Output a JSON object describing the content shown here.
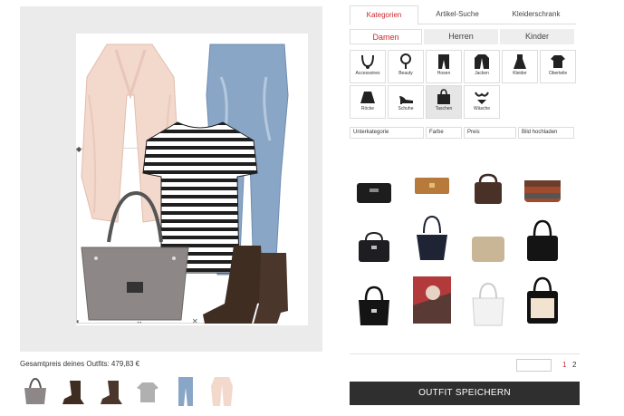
{
  "total_price_text": "Gesamtpreis deines Outfits: 479,83 €",
  "tabs": [
    {
      "label": "Kategorien"
    },
    {
      "label": "Artikel-Suche"
    },
    {
      "label": "Kleiderschrank"
    }
  ],
  "gender_tabs": [
    {
      "label": "Damen"
    },
    {
      "label": "Herren"
    },
    {
      "label": "Kinder"
    }
  ],
  "categories": [
    {
      "label": "Accessoires"
    },
    {
      "label": "Beauty"
    },
    {
      "label": "Hosen"
    },
    {
      "label": "Jacken"
    },
    {
      "label": "Kleider"
    },
    {
      "label": "Oberteile"
    },
    {
      "label": "Röcke"
    },
    {
      "label": "Schuhe"
    },
    {
      "label": "Taschen"
    },
    {
      "label": "Wäsche"
    }
  ],
  "filters": [
    {
      "label": "Unterkategorie"
    },
    {
      "label": "Farbe"
    },
    {
      "label": "Preis"
    },
    {
      "label": "Bild hochladen"
    }
  ],
  "pagination": {
    "page1": "1",
    "page2": "2"
  },
  "save_button": "OUTFIT SPEICHERN",
  "colors": {
    "accent": "#c8282d",
    "button": "#2f2f2f"
  }
}
